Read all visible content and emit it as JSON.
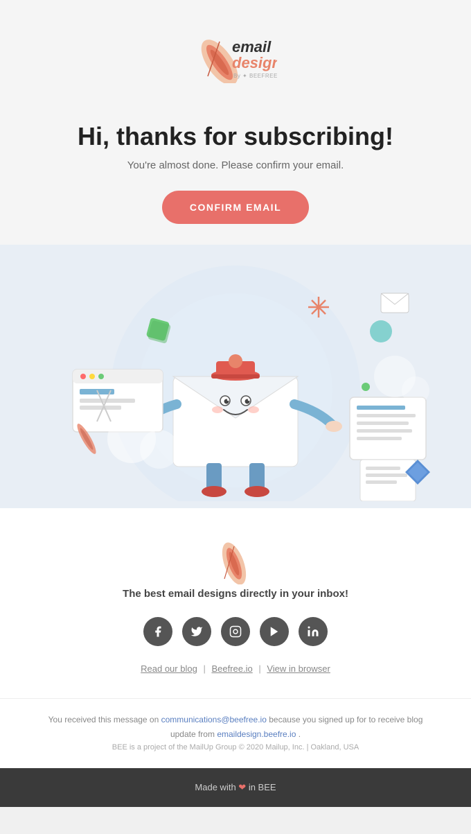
{
  "header": {
    "logo_email": "email",
    "logo_design": "design",
    "logo_byline": "By ✦ BEEFREE.IO"
  },
  "hero": {
    "title": "Hi, thanks for subscribing!",
    "subtitle": "You're almost done. Please confirm your email.",
    "confirm_button": "CONFIRM EMAIL"
  },
  "footer": {
    "tagline": "The best email designs directly in your inbox!",
    "social": [
      {
        "name": "facebook",
        "label": "f"
      },
      {
        "name": "twitter",
        "label": "t"
      },
      {
        "name": "instagram",
        "label": "in"
      },
      {
        "name": "youtube",
        "label": "▶"
      },
      {
        "name": "linkedin",
        "label": "li"
      }
    ],
    "links": [
      {
        "label": "Read our blog",
        "name": "read-our-blog-link"
      },
      {
        "label": "Beefree.io",
        "name": "beefree-link"
      },
      {
        "label": "View in browser",
        "name": "view-in-browser-link"
      }
    ]
  },
  "disclaimer": {
    "message_start": "You received this message on ",
    "email": "communications@beefree.io",
    "message_mid": " because you signed up for  to receive blog update from ",
    "domain": "emaildesign.beefre.io",
    "message_end": " .",
    "company_info": "BEE is a project of the MailUp Group © 2020 Mailup, Inc. | Oakland, USA"
  },
  "bottom_bar": {
    "text_before": "Made with ",
    "heart": "❤",
    "text_after": " in BEE"
  }
}
